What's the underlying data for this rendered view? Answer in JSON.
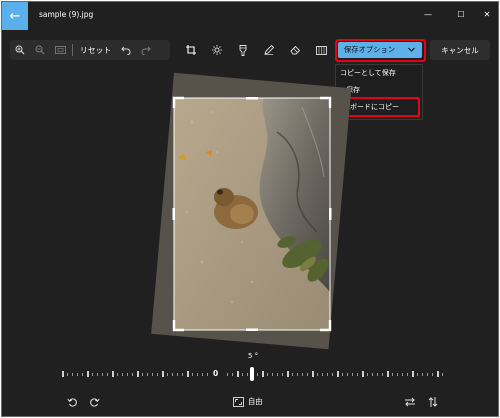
{
  "window": {
    "back_glyph": "←",
    "title": "sample (9).jpg",
    "minimize_glyph": "—",
    "maximize_glyph": "☐",
    "close_glyph": "✕"
  },
  "toolbar": {
    "reset_label": "リセット",
    "save_options_label": "保存オプション",
    "cancel_label": "キャンセル"
  },
  "save_menu": {
    "items": [
      {
        "label": "コピーとして保存"
      },
      {
        "label": "保存"
      },
      {
        "label": "ップボードにコピー"
      }
    ]
  },
  "angle": {
    "readout": "5 °",
    "zero_label": "0",
    "value": 5
  },
  "bottom_bar": {
    "aspect_label": "自由"
  },
  "colors": {
    "accent": "#5fb0e8",
    "highlight": "#e6001a",
    "background": "#202020"
  },
  "icons": {
    "toolbar_left": [
      "zoom-in-icon",
      "zoom-out-icon",
      "actual-size-icon"
    ],
    "toolbar_edit": [
      "crop-icon",
      "adjust-icon",
      "filter-icon",
      "markup-icon",
      "erase-icon",
      "background-icon"
    ],
    "bottom_bar": [
      "rotate-left-icon",
      "rotate-right-icon",
      "aspect-ratio-icon",
      "flip-horizontal-icon",
      "flip-vertical-icon"
    ]
  }
}
